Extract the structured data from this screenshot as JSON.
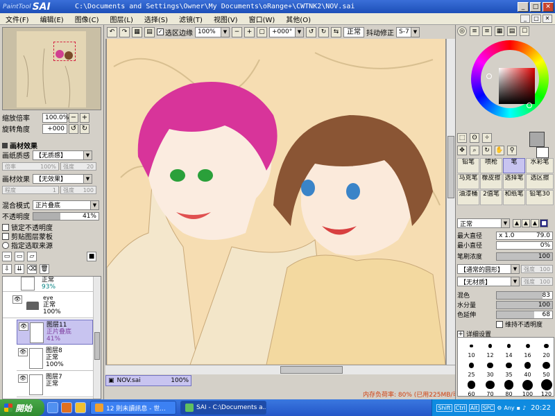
{
  "titlebar": {
    "logo_small": "PaintTool",
    "logo_big": "SAI",
    "path": "C:\\Documents and Settings\\Owner\\My Documents\\oRange+\\CWTNK2\\NOV.sai"
  },
  "menu": [
    "文件(F)",
    "编辑(E)",
    "图像(C)",
    "图层(L)",
    "选择(S)",
    "滤镜(T)",
    "视图(V)",
    "窗口(W)",
    "其他(O)"
  ],
  "toolbar": {
    "selection_edge_label": "选区边缘",
    "zoom_value": "100%",
    "rotate_value": "+000°",
    "blend_mode": "正常",
    "stabilizer_label": "抖动修正",
    "stabilizer_value": "S-7"
  },
  "navigator": {
    "zoom_label": "缩放倍率",
    "zoom_value": "100.0%",
    "angle_label": "旋转角度",
    "angle_value": "+000"
  },
  "material_effect": {
    "section_title": "画材效果",
    "paper_texture_label": "画纸质感",
    "paper_texture_value": "【无质感】",
    "scale_label": "倍率",
    "scale_value": "100%",
    "strength_label": "强度",
    "strength_value": "20",
    "effect_label": "画材效果",
    "effect_value": "【无效果】",
    "width_label": "程度",
    "width_value": "1",
    "strength2_label": "强度",
    "strength2_value": "100"
  },
  "layer_props": {
    "blend_label": "混合模式",
    "blend_value": "正片叠底",
    "opacity_label": "不透明度",
    "opacity_value": "41%",
    "opacity_fraction": 0.41,
    "lock_opacity": "锁定不透明度",
    "clip_layer": "剪贴图层蒙板",
    "selection_source": "指定选取来源"
  },
  "layers": [
    {
      "name": "",
      "mode": "正常",
      "opacity": "93%"
    },
    {
      "name": "eye",
      "mode": "正常",
      "opacity": "100%"
    },
    {
      "name": "图层11",
      "mode": "正片叠底",
      "opacity": "41%"
    },
    {
      "name": "图层8",
      "mode": "正常",
      "opacity": "100%"
    },
    {
      "name": "图层7",
      "mode": "正常",
      "opacity": ""
    }
  ],
  "brushes": [
    [
      "铅笔",
      "喷枪",
      "笔",
      "水彩笔"
    ],
    [
      "马克笔",
      "橡皮擦",
      "选择笔",
      "选区擦"
    ],
    [
      "油漆桶",
      "2值笔",
      "和纸笔",
      "铅笔30"
    ]
  ],
  "brush_settings": {
    "mode": "正常",
    "max_size_label": "最大直径",
    "max_size_mult": "x 1.0",
    "max_size_value": "79.0",
    "min_size_label": "最小直径",
    "min_size_value": "0%",
    "density_label": "笔刷浓度",
    "density_value": "100",
    "shape_value": "【通常的圆形】",
    "shape_strength_label": "强度",
    "shape_strength_value": "100",
    "texture_value": "【无材质】",
    "texture_strength_label": "强度",
    "texture_strength_value": "100",
    "blend_label": "混色",
    "blend_value": "83",
    "water_label": "水分量",
    "water_value": "100",
    "extend_label": "色延伸",
    "extend_value": "68",
    "keep_opacity_label": "维持不透明度",
    "detail_label": "详细设置"
  },
  "brush_sizes": [
    [
      "10",
      "12",
      "14",
      "16",
      "20"
    ],
    [
      "25",
      "30",
      "35",
      "40",
      "50"
    ],
    [
      "60",
      "70",
      "80",
      "100",
      "120"
    ]
  ],
  "status": {
    "doc_name": "NOV.sai",
    "doc_zoom": "100%",
    "memory": "内存负荷率: 80% (已用225MB/可用496MB)"
  },
  "taskbar": {
    "start": "開始",
    "task1": "12 則未讀訊息 - 世...",
    "task2": "SAI - C:\\Documents a...",
    "tray_keys": [
      "Shift",
      "Ctrl",
      "Alt",
      "SPC"
    ],
    "tray_any": "Any",
    "clock": "20:22"
  },
  "colors": {
    "titlebar": "#1d4fb8",
    "canvas_bg": "#f5dcb0",
    "selection": "#c8c4f0",
    "memory_text": "#d04010"
  }
}
